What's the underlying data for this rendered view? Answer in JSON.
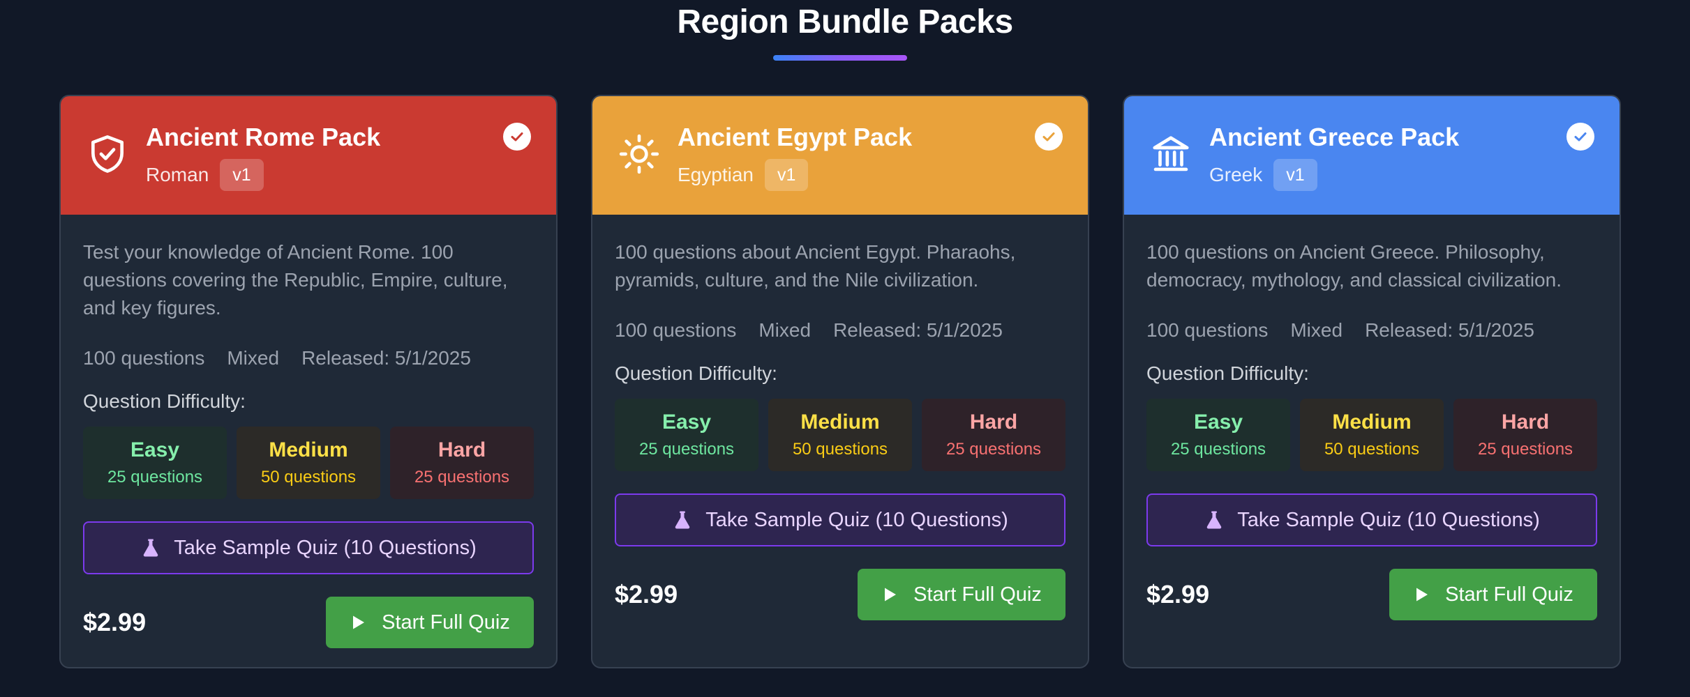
{
  "section": {
    "title": "Region Bundle Packs"
  },
  "colors": {
    "rome": "#ca3a31",
    "egypt": "#e9a23b",
    "greece": "#4a86f0"
  },
  "cards": [
    {
      "name": "Ancient Rome Pack",
      "region": "Roman",
      "version": "v1",
      "icon": "shield-check-icon",
      "description": "Test your knowledge of Ancient Rome. 100 questions covering the Republic, Empire, culture, and key figures.",
      "questions": "100 questions",
      "mode": "Mixed",
      "released": "Released: 5/1/2025",
      "difficulty_label": "Question Difficulty:",
      "easy": {
        "label": "Easy",
        "count": "25 questions"
      },
      "medium": {
        "label": "Medium",
        "count": "50 questions"
      },
      "hard": {
        "label": "Hard",
        "count": "25 questions"
      },
      "sample_label": "Take Sample Quiz (10 Questions)",
      "price": "$2.99",
      "start_label": "Start Full Quiz"
    },
    {
      "name": "Ancient Egypt Pack",
      "region": "Egyptian",
      "version": "v1",
      "icon": "sun-icon",
      "description": "100 questions about Ancient Egypt. Pharaohs, pyramids, culture, and the Nile civilization.",
      "questions": "100 questions",
      "mode": "Mixed",
      "released": "Released: 5/1/2025",
      "difficulty_label": "Question Difficulty:",
      "easy": {
        "label": "Easy",
        "count": "25 questions"
      },
      "medium": {
        "label": "Medium",
        "count": "50 questions"
      },
      "hard": {
        "label": "Hard",
        "count": "25 questions"
      },
      "sample_label": "Take Sample Quiz (10 Questions)",
      "price": "$2.99",
      "start_label": "Start Full Quiz"
    },
    {
      "name": "Ancient Greece Pack",
      "region": "Greek",
      "version": "v1",
      "icon": "temple-icon",
      "description": "100 questions on Ancient Greece. Philosophy, democracy, mythology, and classical civilization.",
      "questions": "100 questions",
      "mode": "Mixed",
      "released": "Released: 5/1/2025",
      "difficulty_label": "Question Difficulty:",
      "easy": {
        "label": "Easy",
        "count": "25 questions"
      },
      "medium": {
        "label": "Medium",
        "count": "50 questions"
      },
      "hard": {
        "label": "Hard",
        "count": "25 questions"
      },
      "sample_label": "Take Sample Quiz (10 Questions)",
      "price": "$2.99",
      "start_label": "Start Full Quiz"
    }
  ]
}
